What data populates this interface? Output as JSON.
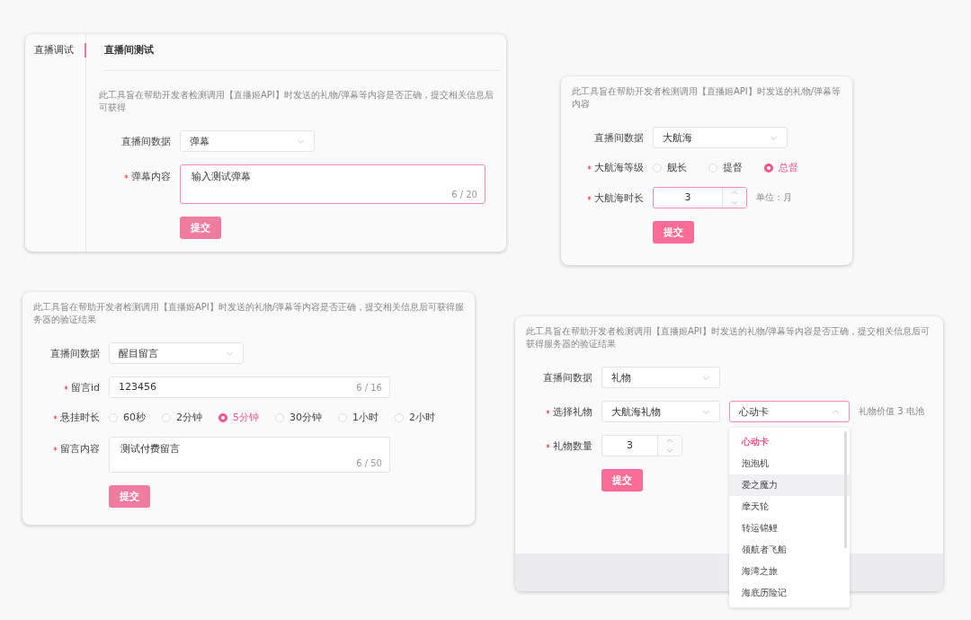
{
  "panels": [
    {
      "sidebar": [
        {
          "label": "直播调试",
          "selected": true
        }
      ],
      "title": "直播间测试",
      "description": "此工具旨在帮助开发者检测调用【直播姬API】时发送的礼物/弹幕等内容是否正确，提交相关信息后可获得",
      "fields": [
        {
          "kind": "select",
          "label": "直播间数据",
          "required": false,
          "value": "弹幕"
        },
        {
          "kind": "textarea",
          "label": "弹幕内容",
          "required": true,
          "value": "输入测试弹幕",
          "counter": "6 / 20",
          "focused": true
        }
      ],
      "submit": "提交"
    },
    {
      "description": "此工具旨在帮助开发者检测调用【直播姬API】时发送的礼物/弹幕等内容",
      "fields": [
        {
          "kind": "select",
          "label": "直播间数据",
          "required": false,
          "value": "大航海"
        },
        {
          "kind": "radio",
          "label": "大航海等级",
          "required": true,
          "options": [
            {
              "label": "舰长",
              "selected": false
            },
            {
              "label": "提督",
              "selected": false
            },
            {
              "label": "总督",
              "selected": true
            }
          ]
        },
        {
          "kind": "number",
          "label": "大航海时长",
          "required": true,
          "value": "3",
          "focused": true,
          "unit": "单位：月"
        }
      ],
      "submit": "提交"
    },
    {
      "description": "此工具旨在帮助开发者检测调用【直播姬API】时发送的礼物/弹幕等内容是否正确，提交相关信息后可获得服务器的验证结果",
      "fields": [
        {
          "kind": "select",
          "label": "直播间数据",
          "required": false,
          "value": "醒目留言"
        },
        {
          "kind": "text",
          "label": "留言id",
          "required": true,
          "value": "123456",
          "counter": "6 / 16"
        },
        {
          "kind": "radio",
          "label": "悬挂时长",
          "required": true,
          "options": [
            {
              "label": "60秒",
              "selected": false
            },
            {
              "label": "2分钟",
              "selected": false
            },
            {
              "label": "5分钟",
              "selected": true
            },
            {
              "label": "30分钟",
              "selected": false
            },
            {
              "label": "1小时",
              "selected": false
            },
            {
              "label": "2小时",
              "selected": false
            }
          ]
        },
        {
          "kind": "textarea",
          "label": "留言内容",
          "required": true,
          "value": "测试付费留言",
          "counter": "6 / 50",
          "focused": false
        }
      ],
      "submit": "提交"
    },
    {
      "description": "此工具旨在帮助开发者检测调用【直播姬API】时发送的礼物/弹幕等内容是否正确，提交相关信息后可获得服务器的验证结果",
      "fields": [
        {
          "kind": "select",
          "label": "直播间数据",
          "required": false,
          "value": "礼物"
        },
        {
          "kind": "gift",
          "label": "选择礼物",
          "required": true,
          "value": "大航海礼物",
          "second": {
            "value": "心动卡",
            "open": true,
            "options": [
              {
                "label": "心动卡",
                "selected": true,
                "hovered": false
              },
              {
                "label": "泡泡机",
                "selected": false,
                "hovered": false
              },
              {
                "label": "爱之魔力",
                "selected": false,
                "hovered": true
              },
              {
                "label": "摩天轮",
                "selected": false,
                "hovered": false
              },
              {
                "label": "转运锦鲤",
                "selected": false,
                "hovered": false
              },
              {
                "label": "领航者飞船",
                "selected": false,
                "hovered": false
              },
              {
                "label": "海湾之旅",
                "selected": false,
                "hovered": false
              },
              {
                "label": "海底历险记",
                "selected": false,
                "hovered": false
              }
            ]
          },
          "note": "礼物价值 3 电池"
        },
        {
          "kind": "number",
          "label": "礼物数量",
          "required": true,
          "value": "3",
          "focused": false
        }
      ],
      "submit": "提交"
    }
  ]
}
